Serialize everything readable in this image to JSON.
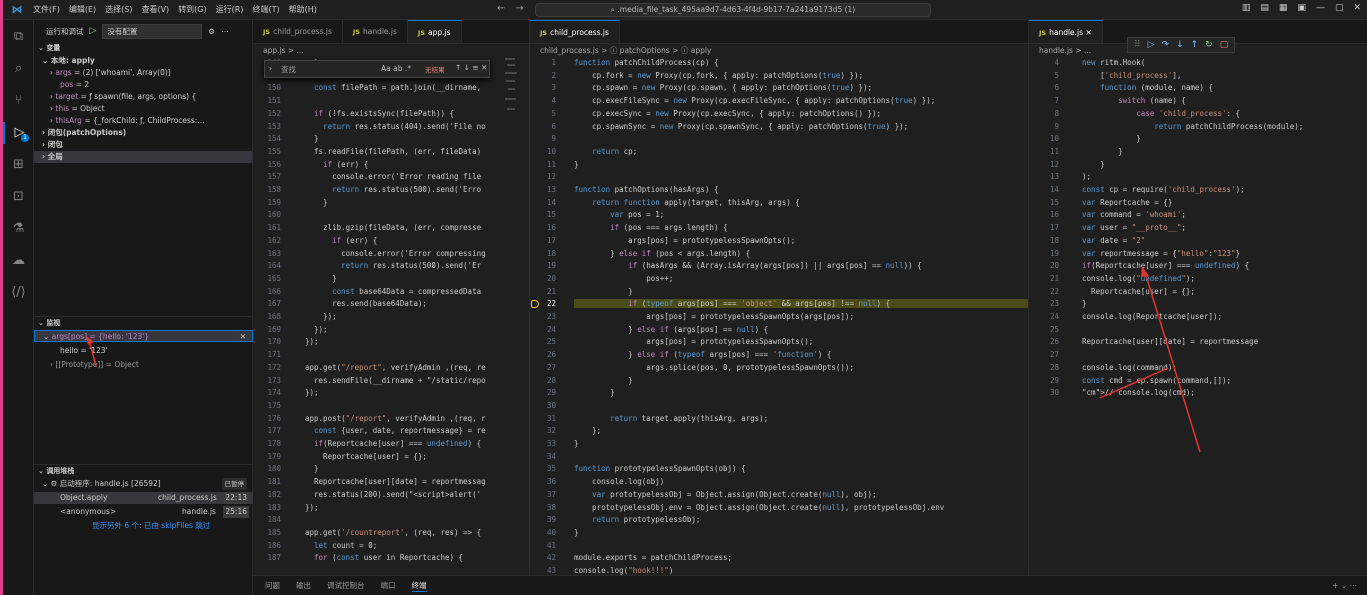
{
  "menu": [
    "文件(F)",
    "编辑(E)",
    "选择(S)",
    "查看(V)",
    "转到(G)",
    "运行(R)",
    "终端(T)",
    "帮助(H)"
  ],
  "command_center": ".media_file_task_495aa9d7-4d63-4f4d-9b17-7a241a9173d5 (1)",
  "sidebar": {
    "run_label": "运行和调试",
    "config": "没有配置",
    "variables_title": "变量",
    "local_title": "本地: apply",
    "vars": [
      {
        "name": "args",
        "value": "= (2) ['whoami', Array(0)]"
      },
      {
        "name": "pos",
        "value": "= 2"
      },
      {
        "name": "target",
        "value": "= ƒ spawn(file, args, options) {"
      },
      {
        "name": "this",
        "value": "= Object"
      },
      {
        "name": "thisArg",
        "value": "= {_forkChild: ƒ, ChildProcess:…"
      }
    ],
    "scopes": [
      "闭包(patchOptions)",
      "闭包",
      "全局"
    ],
    "watch_title": "监视",
    "watch_expr": "args[pos] = {hello: '123'}",
    "watch_children": [
      "hello = '123'",
      "[[Prototype]] = Object"
    ],
    "callstack_title": "调用堆栈",
    "thread": "启动程序: handle.js [26592]",
    "thread_state": "已暂停",
    "frames": [
      {
        "name": "Object.apply",
        "file": "child_process.js",
        "pos": "22:13"
      },
      {
        "name": "<anonymous>",
        "file": "handle.js",
        "pos": "25:16"
      }
    ],
    "skip_note": "显示另外 6 个: 已由 skipFiles 跳过"
  },
  "group1": {
    "tabs": [
      "child_process.js",
      "handle.js",
      "app.js"
    ],
    "crumb": "app.js > ...",
    "find_label": "查找",
    "find_result": "无结果"
  },
  "group2": {
    "tab": "child_process.js",
    "crumb": "child_process.js > ⓘ patchOptions > ⓘ apply"
  },
  "group3": {
    "tab": "handle.js",
    "crumb": "handle.js > ..."
  },
  "panel_tabs": [
    "问题",
    "输出",
    "调试控制台",
    "端口",
    "终端"
  ]
}
